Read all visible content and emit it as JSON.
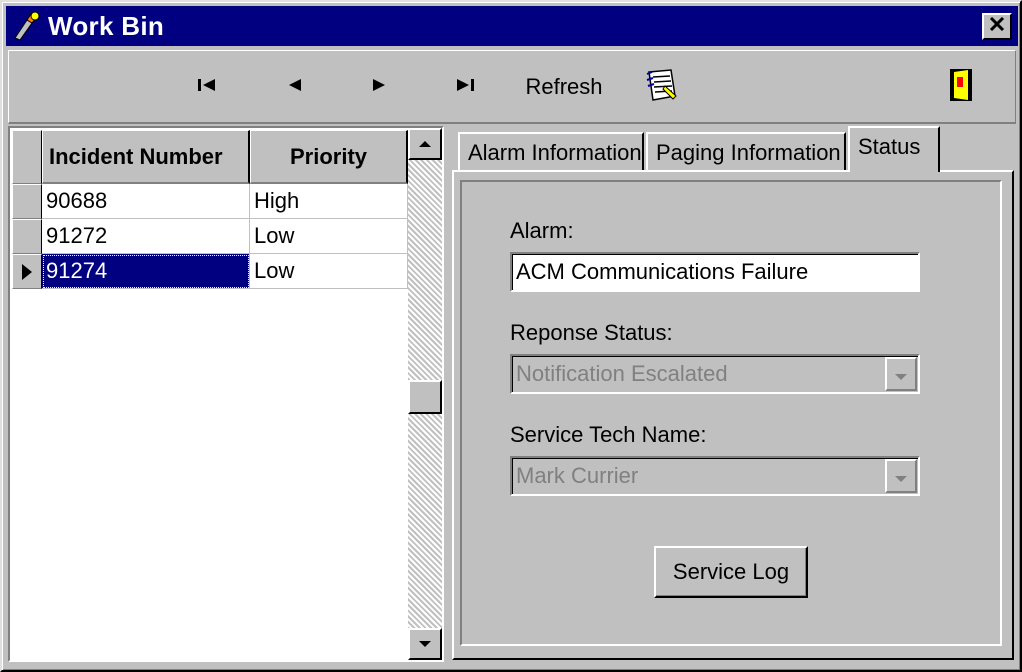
{
  "window": {
    "title": "Work Bin",
    "title_icon": "flashlight-icon",
    "close_icon": "close-icon"
  },
  "toolbar": {
    "first_icon": "first-record-icon",
    "prev_icon": "previous-record-icon",
    "next_icon": "next-record-icon",
    "last_icon": "last-record-icon",
    "refresh_label": "Refresh",
    "notes_icon": "notepad-icon",
    "exit_icon": "exit-door-icon"
  },
  "grid": {
    "columns": [
      "Incident Number",
      "Priority"
    ],
    "rows": [
      {
        "incident": "90688",
        "priority": "High"
      },
      {
        "incident": "91272",
        "priority": "Low"
      },
      {
        "incident": "91274",
        "priority": "Low"
      }
    ],
    "selected_row": 2
  },
  "tabs": [
    {
      "label": "Alarm Information"
    },
    {
      "label": "Paging Information"
    },
    {
      "label": "Status"
    }
  ],
  "active_tab": "Status",
  "status_panel": {
    "alarm_label": "Alarm:",
    "alarm_value": "ACM Communications Failure",
    "response_label": "Reponse Status:",
    "response_value": "Notification Escalated",
    "tech_label": "Service Tech Name:",
    "tech_value": "Mark Currier",
    "service_log_button": "Service Log"
  },
  "colors": {
    "title_bar": "#000080",
    "selection": "#000080",
    "face": "#c0c0c0"
  }
}
